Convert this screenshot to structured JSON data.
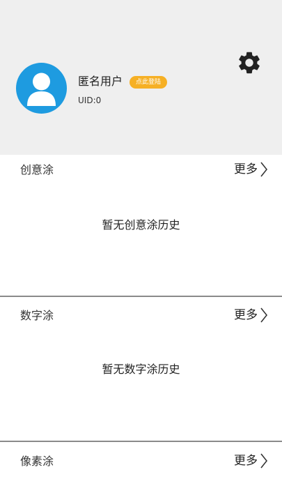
{
  "profile": {
    "username": "匿名用户",
    "login_badge": "点此登陆",
    "uid": "UID:0",
    "avatar_icon": "user-avatar-icon",
    "settings_icon": "gear-icon"
  },
  "sections": [
    {
      "title": "创意涂",
      "more_label": "更多",
      "empty_text": "暂无创意涂历史"
    },
    {
      "title": "数字涂",
      "more_label": "更多",
      "empty_text": "暂无数字涂历史"
    },
    {
      "title": "像素涂",
      "more_label": "更多"
    }
  ],
  "colors": {
    "header_bg": "#efefef",
    "avatar_bg": "#1e9be0",
    "badge_bg": "#f6b025",
    "divider": "#8a8a8a"
  }
}
